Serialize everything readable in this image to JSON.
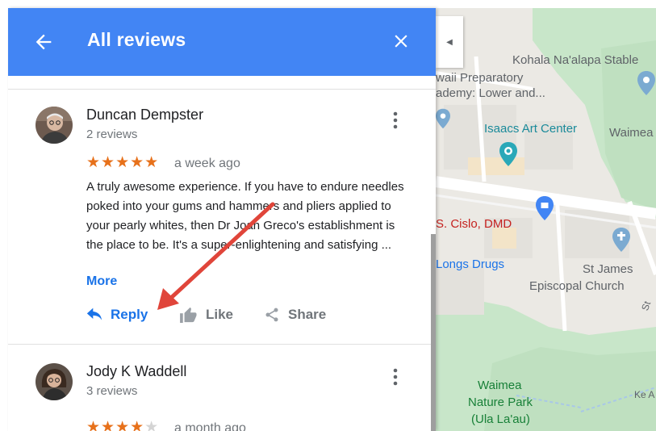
{
  "panel": {
    "header": {
      "title": "All reviews",
      "back_icon": "arrow-left-icon",
      "close_icon": "close-icon"
    },
    "reviews": [
      {
        "name": "Duncan Dempster",
        "review_count": "2 reviews",
        "rating": 5,
        "max_rating": 5,
        "stars_filled": "★★★★★",
        "stars_empty": "",
        "date": "a week ago",
        "text": "A truly awesome experience. If you have to endure needles poked into your gums and hammers and pliers applied to your pearly whites, then Dr Joan Greco's establishment is the place to be. It's a super-enlightening and satisfying ...",
        "more_label": "More",
        "actions": {
          "reply": "Reply",
          "like": "Like",
          "share": "Share"
        }
      },
      {
        "name": "Jody K Waddell",
        "review_count": "3 reviews",
        "rating": 4,
        "max_rating": 5,
        "stars_filled": "★★★★",
        "stars_empty": "★",
        "date": "a month ago"
      }
    ]
  },
  "map": {
    "labels": {
      "kohala": "Kohala Na'alapa Stable",
      "prep_1": "waii Preparatory",
      "prep_2": "ademy: Lower and...",
      "isaacs": "Isaacs Art Center",
      "waimea": "Waimea",
      "cislo": "S. Cislo, DMD",
      "longs": "Longs Drugs",
      "stjames_1": "St James",
      "stjames_2": "Episcopal Church",
      "park_1": "Waimea",
      "park_2": "Nature Park",
      "park_3": "(Ula La'au)",
      "road_st": "St",
      "road_ke": "Ke A"
    },
    "colors": {
      "park_green": "#c8e6c9",
      "road": "#ffffff",
      "block": "#e3e1dc",
      "accent_blue": "#4285f4"
    }
  },
  "annotation": {
    "arrow_color": "#e0453a",
    "target": "reply-button"
  }
}
